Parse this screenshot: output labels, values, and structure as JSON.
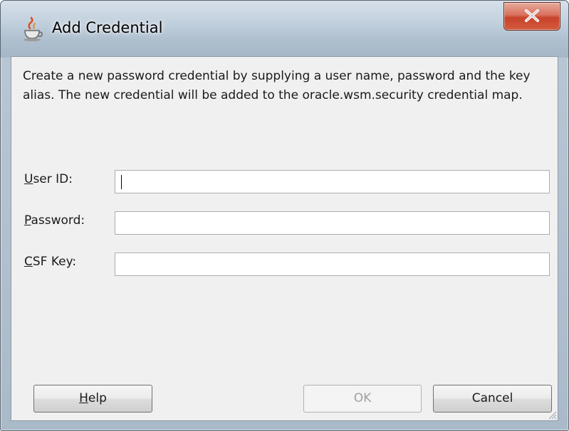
{
  "window": {
    "title": "Add Credential",
    "close_glyph": "x",
    "title_icon": "java-cup-icon"
  },
  "description": "Create a new password credential by supplying a user name, password and the key alias.  The new credential will be added to the oracle.wsm.security credential map.",
  "fields": [
    {
      "label_mnemonic": "U",
      "label_rest": "ser ID:",
      "value": ""
    },
    {
      "label_mnemonic": "P",
      "label_rest": "assword:",
      "value": ""
    },
    {
      "label_mnemonic": "C",
      "label_rest": "SF Key:",
      "value": ""
    }
  ],
  "buttons": {
    "help_mnemonic": "H",
    "help_rest": "elp",
    "ok_label": "OK",
    "ok_enabled": false,
    "cancel_label": "Cancel"
  }
}
